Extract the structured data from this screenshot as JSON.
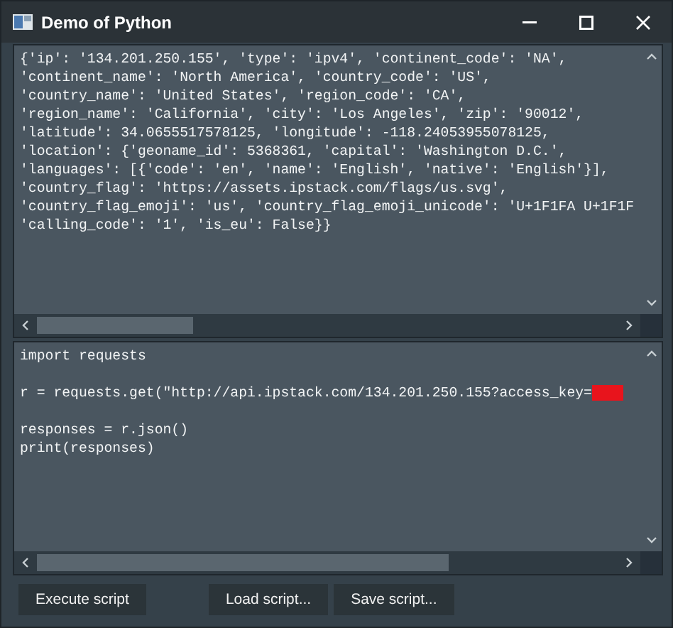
{
  "window": {
    "title": "Demo of Python"
  },
  "output": {
    "lines": [
      "{'ip': '134.201.250.155', 'type': 'ipv4', 'continent_code': 'NA',",
      "'continent_name': 'North America', 'country_code': 'US',",
      "'country_name': 'United States', 'region_code': 'CA',",
      "'region_name': 'California', 'city': 'Los Angeles', 'zip': '90012',",
      "'latitude': 34.0655517578125, 'longitude': -118.24053955078125,",
      "'location': {'geoname_id': 5368361, 'capital': 'Washington D.C.',",
      "'languages': [{'code': 'en', 'name': 'English', 'native': 'English'}],",
      "'country_flag': 'https://assets.ipstack.com/flags/us.svg',",
      "'country_flag_emoji': 'us', 'country_flag_emoji_unicode': 'U+1F1FA U+1F1F",
      "'calling_code': '1', 'is_eu': False}}"
    ]
  },
  "script": {
    "blocks": [
      [
        {
          "text": "import requests",
          "redacted": false
        }
      ],
      [
        {
          "text": "r = requests.get(\"http://api.ipstack.com/134.201.250.155?access_key=",
          "redacted": true
        }
      ],
      [
        {
          "text": "responses = r.json()",
          "redacted": false
        },
        {
          "text": "print(responses)",
          "redacted": false
        }
      ]
    ]
  },
  "run_buttons": [
    "Execute script"
  ],
  "file_buttons": [
    "Load script...",
    "Save script..."
  ]
}
